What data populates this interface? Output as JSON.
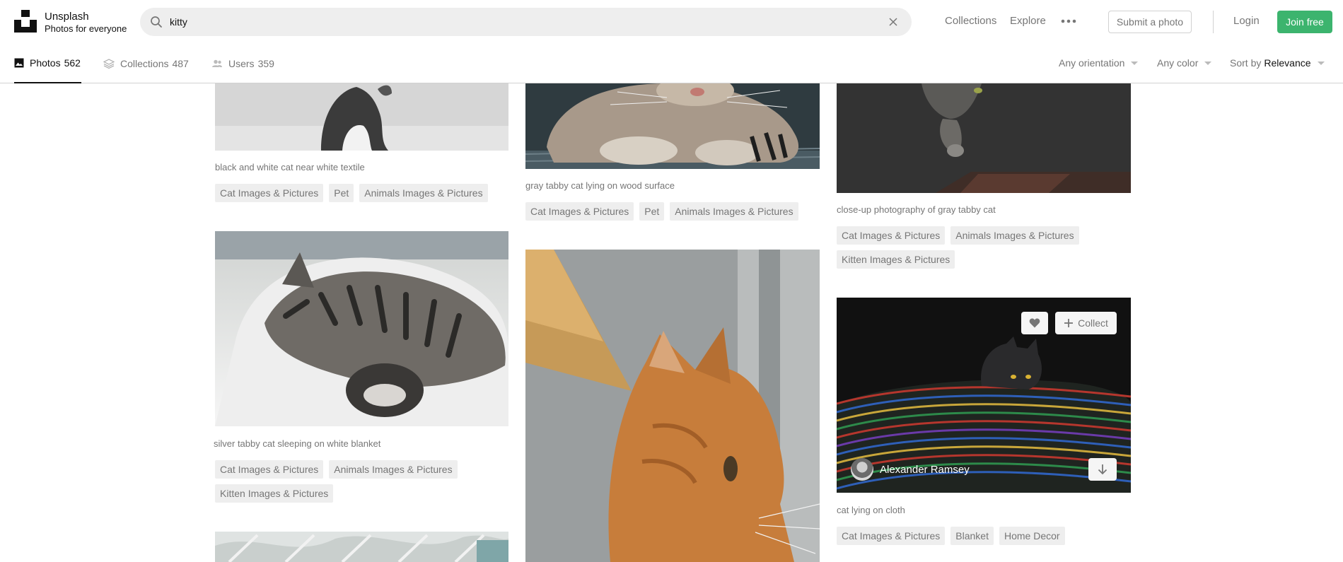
{
  "header": {
    "brand": "Unsplash",
    "tagline": "Photos for everyone",
    "search_value": "kitty",
    "nav": {
      "collections": "Collections",
      "explore": "Explore",
      "submit": "Submit a photo",
      "login": "Login",
      "join": "Join free"
    }
  },
  "tabs": [
    {
      "label": "Photos",
      "count": "562"
    },
    {
      "label": "Collections",
      "count": "487"
    },
    {
      "label": "Users",
      "count": "359"
    }
  ],
  "filters": {
    "orientation": "Any orientation",
    "color": "Any color",
    "sort_prefix": "Sort by",
    "sort_value": "Relevance"
  },
  "photos": [
    {
      "caption": "black and white cat near white textile",
      "tags": [
        "Cat Images & Pictures",
        "Pet",
        "Animals Images & Pictures"
      ]
    },
    {
      "caption": "silver tabby cat sleeping on white blanket",
      "tags": [
        "Cat Images & Pictures",
        "Animals Images & Pictures",
        "Kitten Images & Pictures"
      ]
    },
    {
      "caption": "gray tabby cat lying on wood surface",
      "tags": [
        "Cat Images & Pictures",
        "Pet",
        "Animals Images & Pictures"
      ]
    },
    {
      "caption": "close-up photography of gray tabby cat",
      "tags": [
        "Cat Images & Pictures",
        "Animals Images & Pictures",
        "Kitten Images & Pictures"
      ]
    },
    {
      "caption": "cat lying on cloth",
      "tags": [
        "Cat Images & Pictures",
        "Blanket",
        "Home Decor"
      ],
      "author": "Alexander Ramsey",
      "collect_label": "Collect"
    }
  ],
  "colors": {
    "brand_green": "#3cb46e",
    "muted_text": "#767676",
    "tag_bg": "#eeeeee"
  }
}
